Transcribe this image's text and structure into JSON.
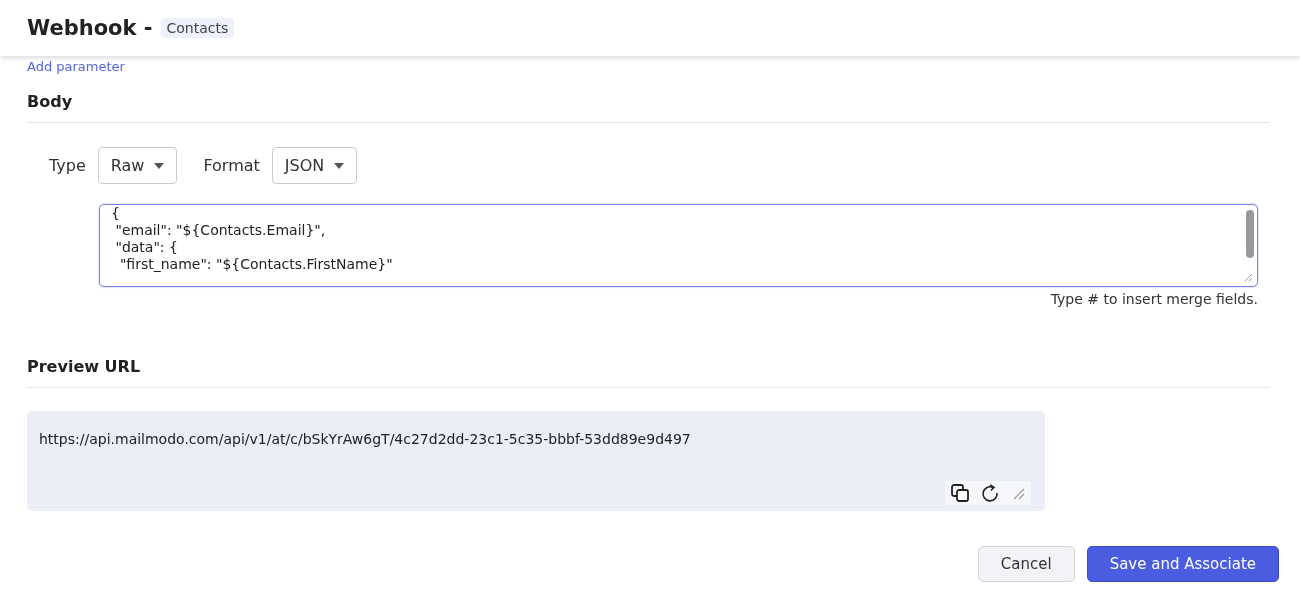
{
  "header": {
    "title": "Webhook -",
    "badge": "Contacts"
  },
  "add_parameter_link": "Add parameter",
  "body_section": {
    "title": "Body",
    "type": {
      "label": "Type",
      "value": "Raw"
    },
    "format": {
      "label": "Format",
      "value": "JSON"
    },
    "code_lines": [
      "{",
      " \"email\": \"${Contacts.Email}\",",
      " \"data\": {",
      "  \"first_name\": \"${Contacts.FirstName}\""
    ],
    "hint": "Type # to insert merge fields."
  },
  "preview_section": {
    "title": "Preview URL",
    "url": "https://api.mailmodo.com/api/v1/at/c/bSkYrAw6gT/4c27d2dd-23c1-5c35-bbbf-53dd89e9d497"
  },
  "buttons": [
    {
      "label": "Cancel",
      "kind": "secondary"
    },
    {
      "label": "Save and Associate",
      "kind": "primary"
    }
  ]
}
